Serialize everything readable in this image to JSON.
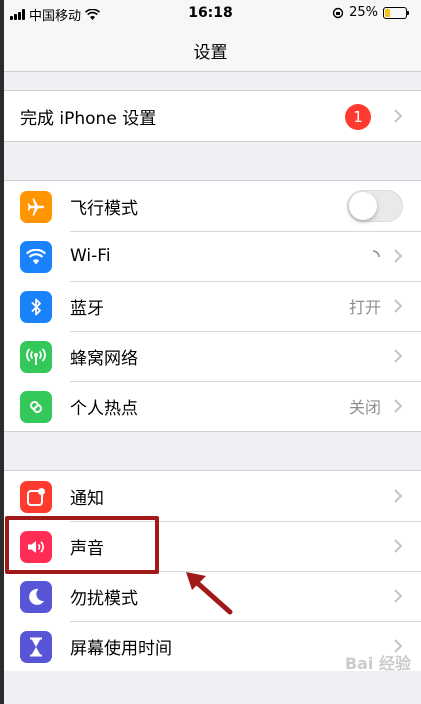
{
  "status_bar": {
    "carrier": "中国移动",
    "time": "16:18",
    "battery_percent": "25%",
    "battery_level": 0.25
  },
  "nav": {
    "title": "设置"
  },
  "setup": {
    "label": "完成 iPhone 设置",
    "badge": "1"
  },
  "connectivity": [
    {
      "label": "飞行模式",
      "icon": "airplane-icon",
      "color": "#ff9500",
      "toggle": false
    },
    {
      "label": "Wi-Fi",
      "icon": "wifi-icon",
      "color": "#1a82fb",
      "value": ""
    },
    {
      "label": "蓝牙",
      "icon": "bluetooth-icon",
      "color": "#1a82fb",
      "value": "打开"
    },
    {
      "label": "蜂窝网络",
      "icon": "cellular-icon",
      "color": "#34c759",
      "value": ""
    },
    {
      "label": "个人热点",
      "icon": "hotspot-icon",
      "color": "#34c759",
      "value": "关闭"
    }
  ],
  "notifications": [
    {
      "label": "通知",
      "icon": "notification-icon",
      "color": "#ff3b30"
    },
    {
      "label": "声音",
      "icon": "speaker-icon",
      "color": "#ff2d55"
    },
    {
      "label": "勿扰模式",
      "icon": "moon-icon",
      "color": "#5856d6"
    },
    {
      "label": "屏幕使用时间",
      "icon": "hourglass-icon",
      "color": "#5856d6"
    }
  ],
  "watermark": "Bai 经验"
}
